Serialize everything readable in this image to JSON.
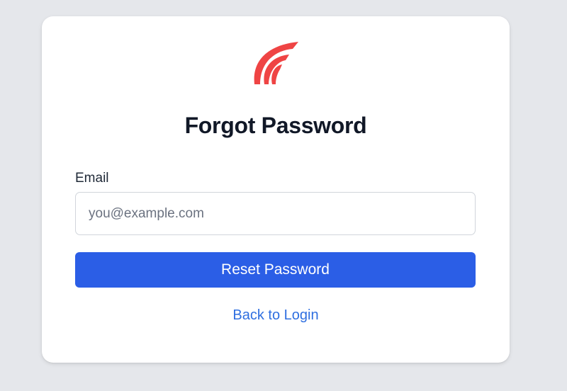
{
  "colors": {
    "page_background": "#e5e7eb",
    "card_background": "#ffffff",
    "brand_red": "#ef4444",
    "primary_button": "#2b5ee6",
    "link": "#2f6fe0",
    "title_text": "#111827"
  },
  "logo": {
    "icon": "brand-logo-icon"
  },
  "form": {
    "title": "Forgot Password",
    "email": {
      "label": "Email",
      "value": "",
      "placeholder": "you@example.com"
    },
    "submit_label": "Reset Password",
    "back_link_label": "Back to Login"
  }
}
